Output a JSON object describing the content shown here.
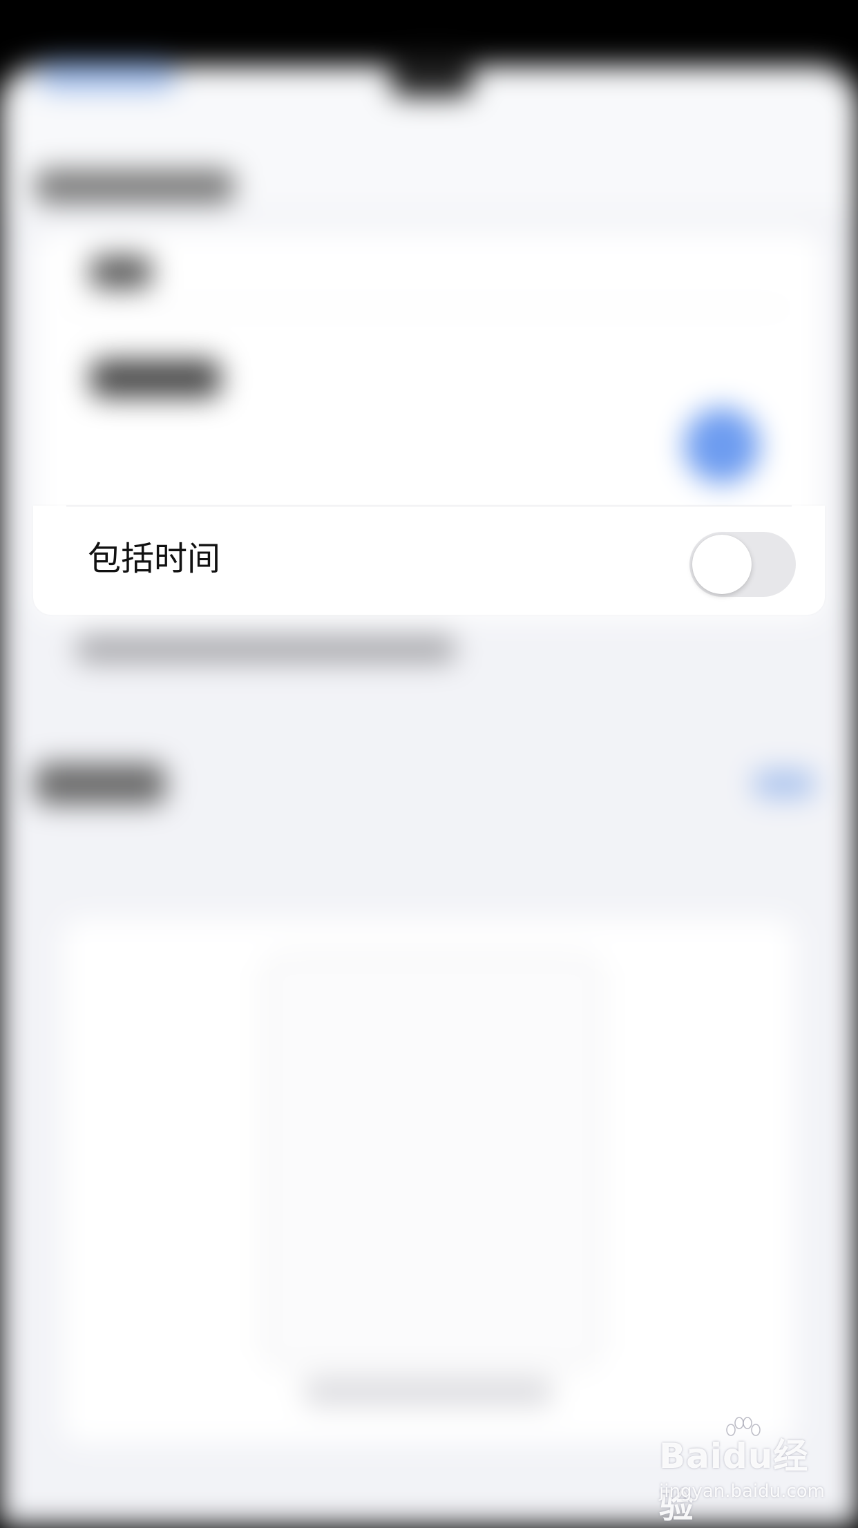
{
  "screen": {
    "background_sheet_color": "#f2f3f7",
    "card_color": "#ffffff"
  },
  "focus_row": {
    "label": "包括时间",
    "toggle": {
      "state": "off",
      "track_color": "#e7e7ea",
      "knob_color": "#ffffff"
    }
  },
  "watermark": {
    "logo_text": "Baidu经验",
    "url": "jingyan.baidu.com",
    "icon": "paw-icon"
  }
}
